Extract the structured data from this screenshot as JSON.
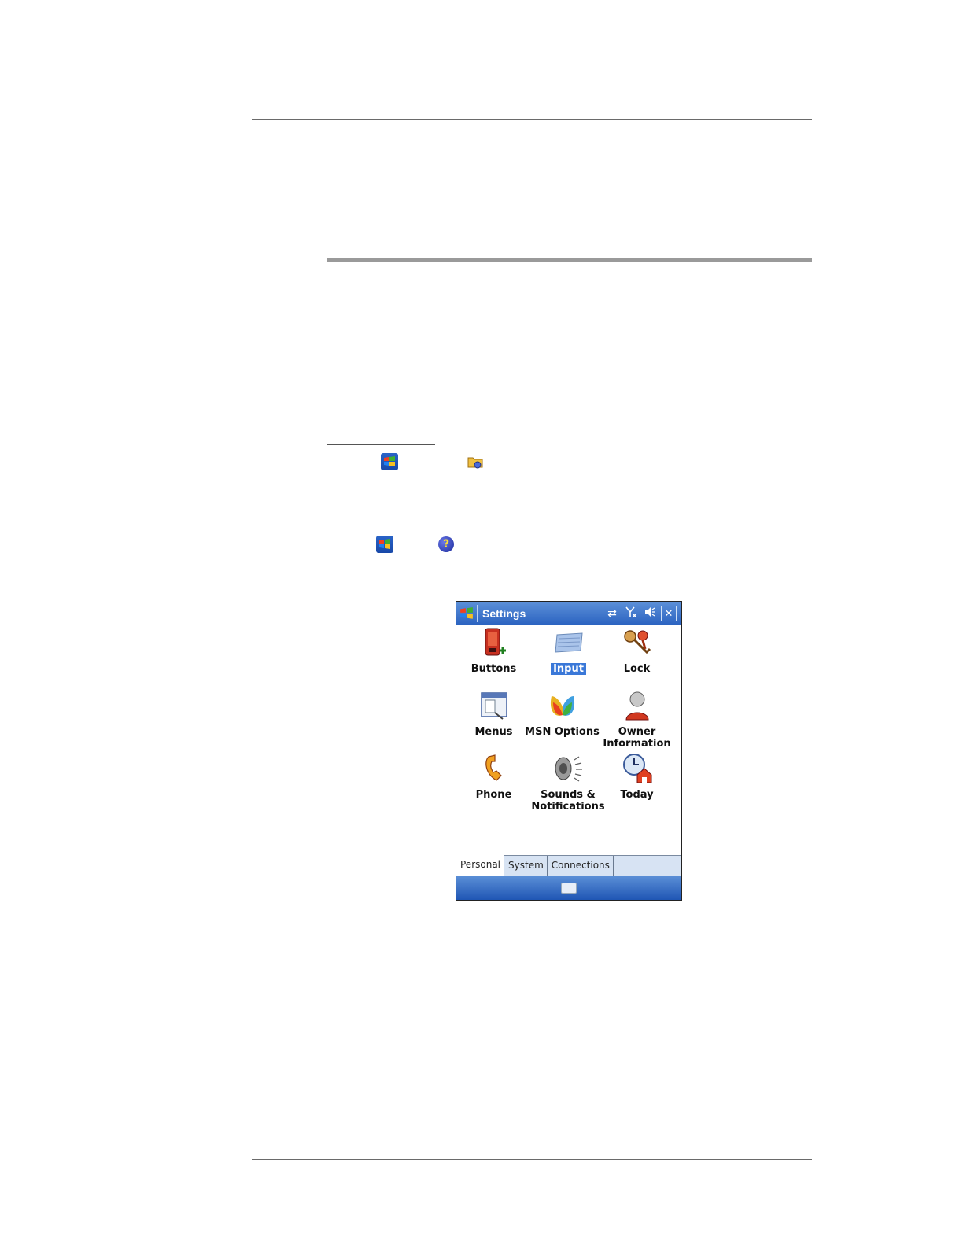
{
  "device": {
    "title": "Settings",
    "icons": {
      "connectivity": "sync-arrows-icon",
      "signal": "no-signal-icon",
      "volume": "speaker-icon",
      "close": "close-icon"
    },
    "close_glyph": "✕",
    "items": [
      {
        "label": "Buttons",
        "icon": "buttons-icon",
        "selected": false
      },
      {
        "label": "Input",
        "icon": "keyboard-icon",
        "selected": true
      },
      {
        "label": "Lock",
        "icon": "keys-icon",
        "selected": false
      },
      {
        "label": "Menus",
        "icon": "menus-icon",
        "selected": false
      },
      {
        "label": "MSN Options",
        "icon": "msn-butterfly-icon",
        "selected": false
      },
      {
        "label": "Owner Information",
        "icon": "owner-icon",
        "selected": false
      },
      {
        "label": "Phone",
        "icon": "phone-icon",
        "selected": false
      },
      {
        "label": "Sounds & Notifications",
        "icon": "speaker-icon",
        "selected": false
      },
      {
        "label": "Today",
        "icon": "today-icon",
        "selected": false
      }
    ],
    "tabs": [
      {
        "label": "Personal",
        "active": true
      },
      {
        "label": "System",
        "active": false
      },
      {
        "label": "Connections",
        "active": false
      }
    ]
  },
  "colors": {
    "titlebar": "#2a62c0",
    "selection": "#3a78d8",
    "tabbar": "#d7e3f3"
  }
}
